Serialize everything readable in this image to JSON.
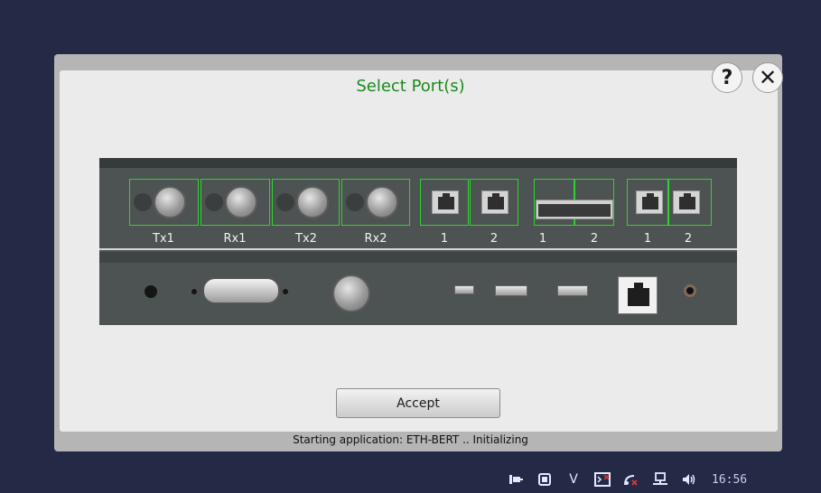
{
  "dialog": {
    "title": "Select Port(s)",
    "help_label": "?",
    "close_label": "✕",
    "accept_label": "Accept"
  },
  "ports": {
    "bnc": [
      {
        "label": "Tx1"
      },
      {
        "label": "Rx1"
      },
      {
        "label": "Tx2"
      },
      {
        "label": "Rx2"
      }
    ],
    "rj45_group1": [
      {
        "label": "1"
      },
      {
        "label": "2"
      }
    ],
    "sfp_group": [
      {
        "label": "1"
      },
      {
        "label": "2"
      }
    ],
    "rj45_group2": [
      {
        "label": "1"
      },
      {
        "label": "2"
      }
    ]
  },
  "status": {
    "text": "Starting application: ETH-BERT .. Initializing"
  },
  "taskbar": {
    "icons": [
      "power-plug-icon",
      "square-icon",
      "v-icon",
      "terminal-icon",
      "satellite-icon",
      "network-icon",
      "speaker-icon"
    ],
    "v_label": "V",
    "clock": "16:56"
  },
  "colors": {
    "background": "#242a45",
    "dialog": "#ebebeb",
    "title": "#1c8a1c",
    "port_highlight": "#2dd42d",
    "panel": "#4d5352"
  }
}
